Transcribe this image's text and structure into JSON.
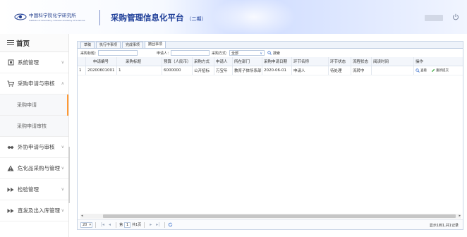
{
  "header": {
    "logo_cn": "中国科学院化学研究所",
    "logo_en": "Institute of Chemistry, Chinese Academy of Sciences",
    "title": "采购管理信息化平台",
    "version": "（二期）"
  },
  "sidebar": {
    "home_label": "首页",
    "items": [
      {
        "label": "系统管理",
        "icon": "settings-icon",
        "chevron": "∨"
      },
      {
        "label": "采购申请与审核",
        "icon": "cart-icon",
        "chevron": "∧"
      },
      {
        "label": "采购申请",
        "sub": true,
        "active": true
      },
      {
        "label": "采购申请审核",
        "sub": true
      },
      {
        "label": "外协申请与审核",
        "icon": "handshake-icon",
        "chevron": "∨"
      },
      {
        "label": "危化品采购与管理",
        "icon": "warning-icon",
        "chevron": "∨"
      },
      {
        "label": "检验管理",
        "icon": "forward-icon",
        "chevron": "∨"
      },
      {
        "label": "直发及出入库管理",
        "icon": "forward-icon",
        "chevron": "∨"
      }
    ]
  },
  "tabs": [
    {
      "label": "草稿",
      "active": false
    },
    {
      "label": "执行中事项",
      "active": false
    },
    {
      "label": "完成事项",
      "active": false
    },
    {
      "label": "撤回事项",
      "active": true
    }
  ],
  "filter": {
    "title_label": "采购标题：",
    "title_value": "",
    "applicant_label": "申请人：",
    "applicant_value": "",
    "method_label": "采购方式：",
    "method_value": "全部",
    "search_label": "搜索"
  },
  "grid": {
    "columns": [
      "",
      "申请编号",
      "采购标题",
      "预算（人民币）",
      "采购方式",
      "申请人",
      "所在部门",
      "采购申请日期",
      "环节名称",
      "环节状态",
      "流程状态",
      "阅读时间",
      "操作"
    ],
    "rows": [
      {
        "num": "1",
        "cells": [
          "20200601001",
          "1",
          "6000000",
          "公开招标",
          "万宝年",
          "教育子体所系部",
          "2020-06-01",
          "申请人",
          "待处理",
          "流转中",
          ""
        ],
        "ops": [
          {
            "label": "查看",
            "icon": "search-icon"
          },
          {
            "label": "重新提交",
            "icon": "pencil-icon"
          }
        ]
      }
    ]
  },
  "pager": {
    "page_size": "20",
    "page_prefix": "第",
    "page_value": "1",
    "page_suffix": "共1页",
    "info": "显示1到1,共1记录"
  },
  "colors": {
    "title_blue": "#1f3f99",
    "border": "#b9c9df",
    "active_marker": "#ff9933",
    "pencil": "#4caf50"
  }
}
